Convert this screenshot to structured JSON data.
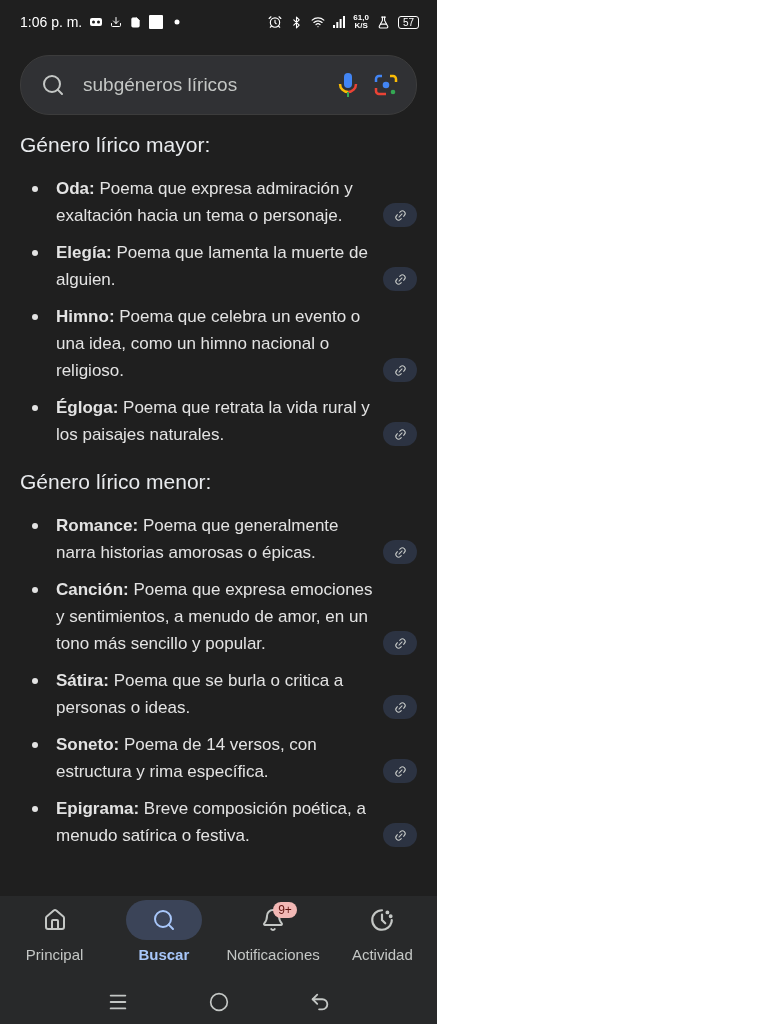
{
  "status_bar": {
    "time": "1:06 p. m.",
    "net_speed": "61,0",
    "net_unit": "K/S",
    "battery": "57"
  },
  "search": {
    "value": "subgéneros líricos"
  },
  "sections": [
    {
      "heading": "Género lírico mayor:",
      "items": [
        {
          "text": "**Oda:** Poema que expresa admiración y exaltación hacia un tema o personaje."
        },
        {
          "text": "**Elegía:** Poema que lamenta la muerte de alguien."
        },
        {
          "text": "**Himno:** Poema que celebra un evento o una idea, como un himno nacional o religioso."
        },
        {
          "text": "**Égloga:** Poema que retrata la vida rural y los paisajes naturales."
        }
      ]
    },
    {
      "heading": "Género lírico menor:",
      "items": [
        {
          "text": "**Romance:** Poema que generalmente narra historias amorosas o épicas."
        },
        {
          "text": "**Canción:** Poema que expresa emociones y sentimientos, a menudo de amor, en un tono más sencillo y popular."
        },
        {
          "text": "**Sátira:** Poema que se burla o critica a personas o ideas."
        },
        {
          "text": "**Soneto:** Poema de 14 versos, con estructura y rima específica."
        },
        {
          "text": "**Epigrama:** Breve composición poética, a menudo satírica o festiva."
        }
      ]
    }
  ],
  "nav": [
    {
      "kind": "home",
      "label": "Principal",
      "selected": false
    },
    {
      "kind": "search",
      "label": "Buscar",
      "selected": true
    },
    {
      "kind": "bell",
      "label": "Notificaciones",
      "selected": false,
      "badge": "9+"
    },
    {
      "kind": "activity",
      "label": "Actividad",
      "selected": false
    }
  ]
}
